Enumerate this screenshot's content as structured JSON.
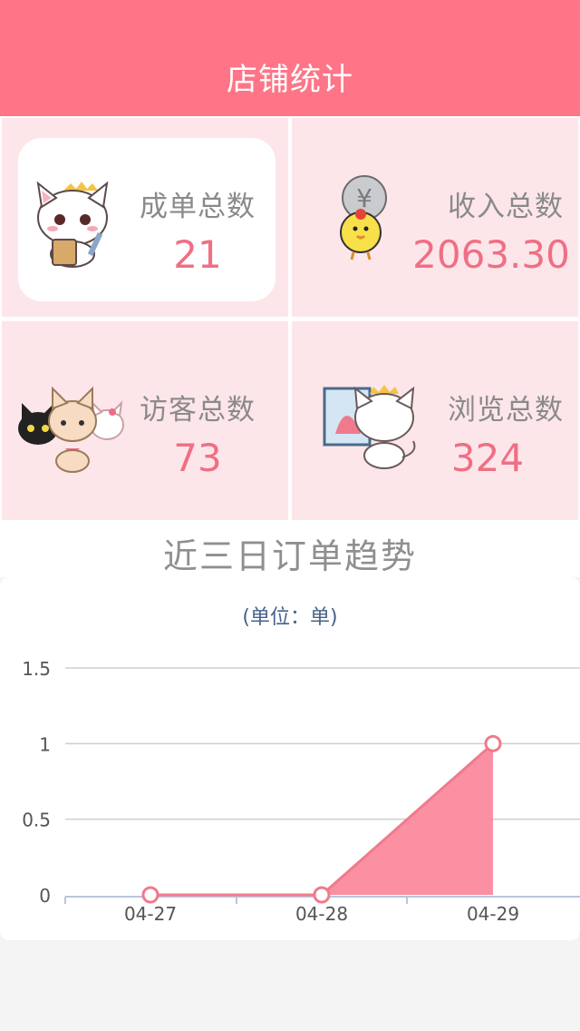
{
  "header": {
    "title": "店铺统计"
  },
  "stats": [
    {
      "label": "成单总数",
      "value": "21",
      "icon": "cat-with-board-icon"
    },
    {
      "label": "收入总数",
      "value": "2063.30",
      "icon": "chick-with-coin-icon"
    },
    {
      "label": "访客总数",
      "value": "73",
      "icon": "three-cats-icon"
    },
    {
      "label": "浏览总数",
      "value": "324",
      "icon": "cat-with-picture-icon"
    }
  ],
  "section": {
    "title": "近三日订单趋势"
  },
  "chart_data": {
    "type": "area",
    "title": "(单位：单)",
    "categories": [
      "04-27",
      "04-28",
      "04-29"
    ],
    "series": [
      {
        "values": [
          0,
          0,
          1
        ]
      }
    ],
    "ylim": [
      0,
      1.5
    ],
    "yticks": [
      "0",
      "0.5",
      "1",
      "1.5"
    ],
    "grid": true,
    "colors": {
      "line": "#f07a8c",
      "fill": "#fb8a9e"
    }
  },
  "colors": {
    "header": "#fe7587",
    "cell": "#fde6ea",
    "value": "#ef6f84"
  }
}
